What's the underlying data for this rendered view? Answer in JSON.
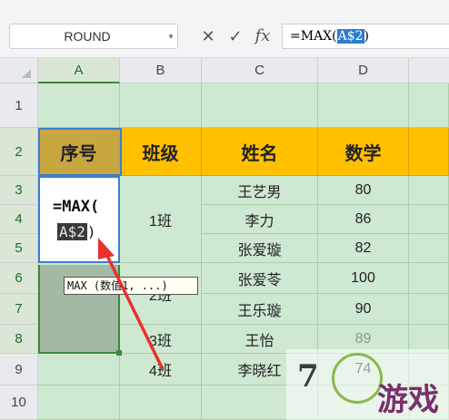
{
  "toolbar": {
    "name_box": "ROUND",
    "cancel_icon": "✕",
    "confirm_icon": "✓",
    "fx_icon": "fx",
    "formula_prefix": "=MAX(",
    "formula_ref": "A$2",
    "formula_suffix": ")"
  },
  "columns": [
    "A",
    "B",
    "C",
    "D"
  ],
  "rows": [
    "1",
    "2",
    "3",
    "4",
    "5",
    "6",
    "7",
    "8",
    "9",
    "10"
  ],
  "table": {
    "headers": [
      "序号",
      "班级",
      "姓名",
      "数学"
    ],
    "classes": [
      "1班",
      "2班",
      "3班",
      "4班"
    ],
    "names": [
      "王艺男",
      "李力",
      "张爱璇",
      "张爱苓",
      "王乐璇",
      "王怡",
      "李晓红"
    ],
    "math": [
      "80",
      "86",
      "82",
      "100",
      "90",
      "89",
      "74"
    ]
  },
  "editing_cell": {
    "line1": "=MAX(",
    "ref": "A$2",
    "line2_suffix": ")"
  },
  "tooltip": "MAX (数值1, ...)",
  "watermark": {
    "text": "游戏",
    "small": "7"
  },
  "colors": {
    "header_fill": "#ffc000",
    "grid_fill": "#cfe8d1",
    "arrow": "#e8322c"
  }
}
